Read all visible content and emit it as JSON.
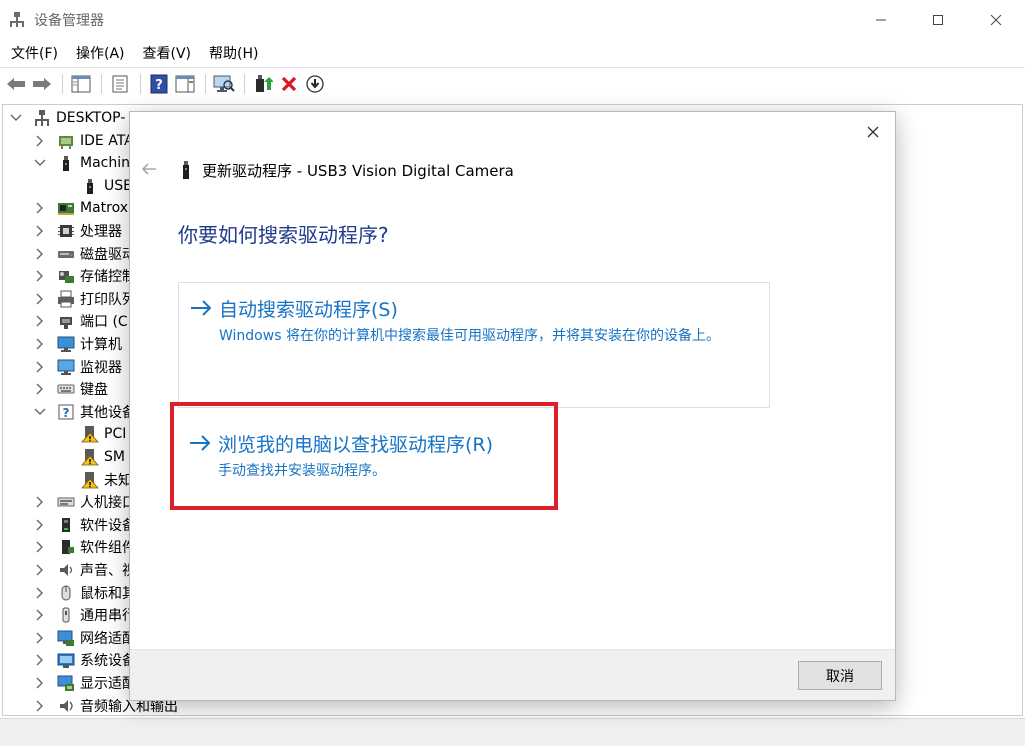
{
  "window": {
    "title": "设备管理器"
  },
  "menu": [
    "文件(F)",
    "操作(A)",
    "查看(V)",
    "帮助(H)"
  ],
  "tree": [
    {
      "label": "DESKTOP-",
      "level": 0,
      "chevron": "down",
      "icon": "computer-icon"
    },
    {
      "label": "IDE ATA",
      "level": 1,
      "chevron": "right",
      "icon": "ide-controller-icon"
    },
    {
      "label": "Machin",
      "level": 1,
      "chevron": "down",
      "icon": "usb-device-icon"
    },
    {
      "label": "USB",
      "level": 2,
      "chevron": "none",
      "icon": "usb-device-icon"
    },
    {
      "label": "Matrox",
      "level": 1,
      "chevron": "right",
      "icon": "card-icon"
    },
    {
      "label": "处理器",
      "level": 1,
      "chevron": "right",
      "icon": "processor-icon"
    },
    {
      "label": "磁盘驱动",
      "level": 1,
      "chevron": "right",
      "icon": "disk-drive-icon"
    },
    {
      "label": "存储控制",
      "level": 1,
      "chevron": "right",
      "icon": "storage-controller-icon"
    },
    {
      "label": "打印队列",
      "level": 1,
      "chevron": "right",
      "icon": "printer-icon"
    },
    {
      "label": "端口 (C",
      "level": 1,
      "chevron": "right",
      "icon": "port-icon"
    },
    {
      "label": "计算机",
      "level": 1,
      "chevron": "right",
      "icon": "computer-monitor-icon"
    },
    {
      "label": "监视器",
      "level": 1,
      "chevron": "right",
      "icon": "monitor-icon"
    },
    {
      "label": "键盘",
      "level": 1,
      "chevron": "right",
      "icon": "keyboard-icon"
    },
    {
      "label": "其他设备",
      "level": 1,
      "chevron": "down",
      "icon": "unknown-device-icon"
    },
    {
      "label": "PCI",
      "level": 2,
      "chevron": "none",
      "icon": "warning-device-icon"
    },
    {
      "label": "SM",
      "level": 2,
      "chevron": "none",
      "icon": "warning-device-icon"
    },
    {
      "label": "未知",
      "level": 2,
      "chevron": "none",
      "icon": "warning-device-icon"
    },
    {
      "label": "人机接口",
      "level": 1,
      "chevron": "right",
      "icon": "hid-icon"
    },
    {
      "label": "软件设备",
      "level": 1,
      "chevron": "right",
      "icon": "software-device-icon"
    },
    {
      "label": "软件组件",
      "level": 1,
      "chevron": "right",
      "icon": "software-component-icon"
    },
    {
      "label": "声音、视",
      "level": 1,
      "chevron": "right",
      "icon": "speaker-icon"
    },
    {
      "label": "鼠标和其",
      "level": 1,
      "chevron": "right",
      "icon": "mouse-icon"
    },
    {
      "label": "通用串行",
      "level": 1,
      "chevron": "right",
      "icon": "usb-controller-icon"
    },
    {
      "label": "网络适配",
      "level": 1,
      "chevron": "right",
      "icon": "network-adapter-icon"
    },
    {
      "label": "系统设备",
      "level": 1,
      "chevron": "right",
      "icon": "system-device-icon"
    },
    {
      "label": "显示适配",
      "level": 1,
      "chevron": "right",
      "icon": "display-adapter-icon"
    },
    {
      "label": "音频输入和输出",
      "level": 1,
      "chevron": "right",
      "icon": "audio-io-icon"
    }
  ],
  "dialog": {
    "header_title": "更新驱动程序 - USB3 Vision Digital Camera",
    "question": "你要如何搜索驱动程序?",
    "option_auto": {
      "title": "自动搜索驱动程序(S)",
      "desc": "Windows 将在你的计算机中搜索最佳可用驱动程序，并将其安装在你的设备上。"
    },
    "option_browse": {
      "title": "浏览我的电脑以查找驱动程序(R)",
      "desc": "手动查找并安装驱动程序。"
    },
    "cancel_label": "取消"
  },
  "colors": {
    "accent_blue": "#1673c6",
    "question_blue": "#1e3a8a",
    "highlight_red": "#e01f26"
  }
}
